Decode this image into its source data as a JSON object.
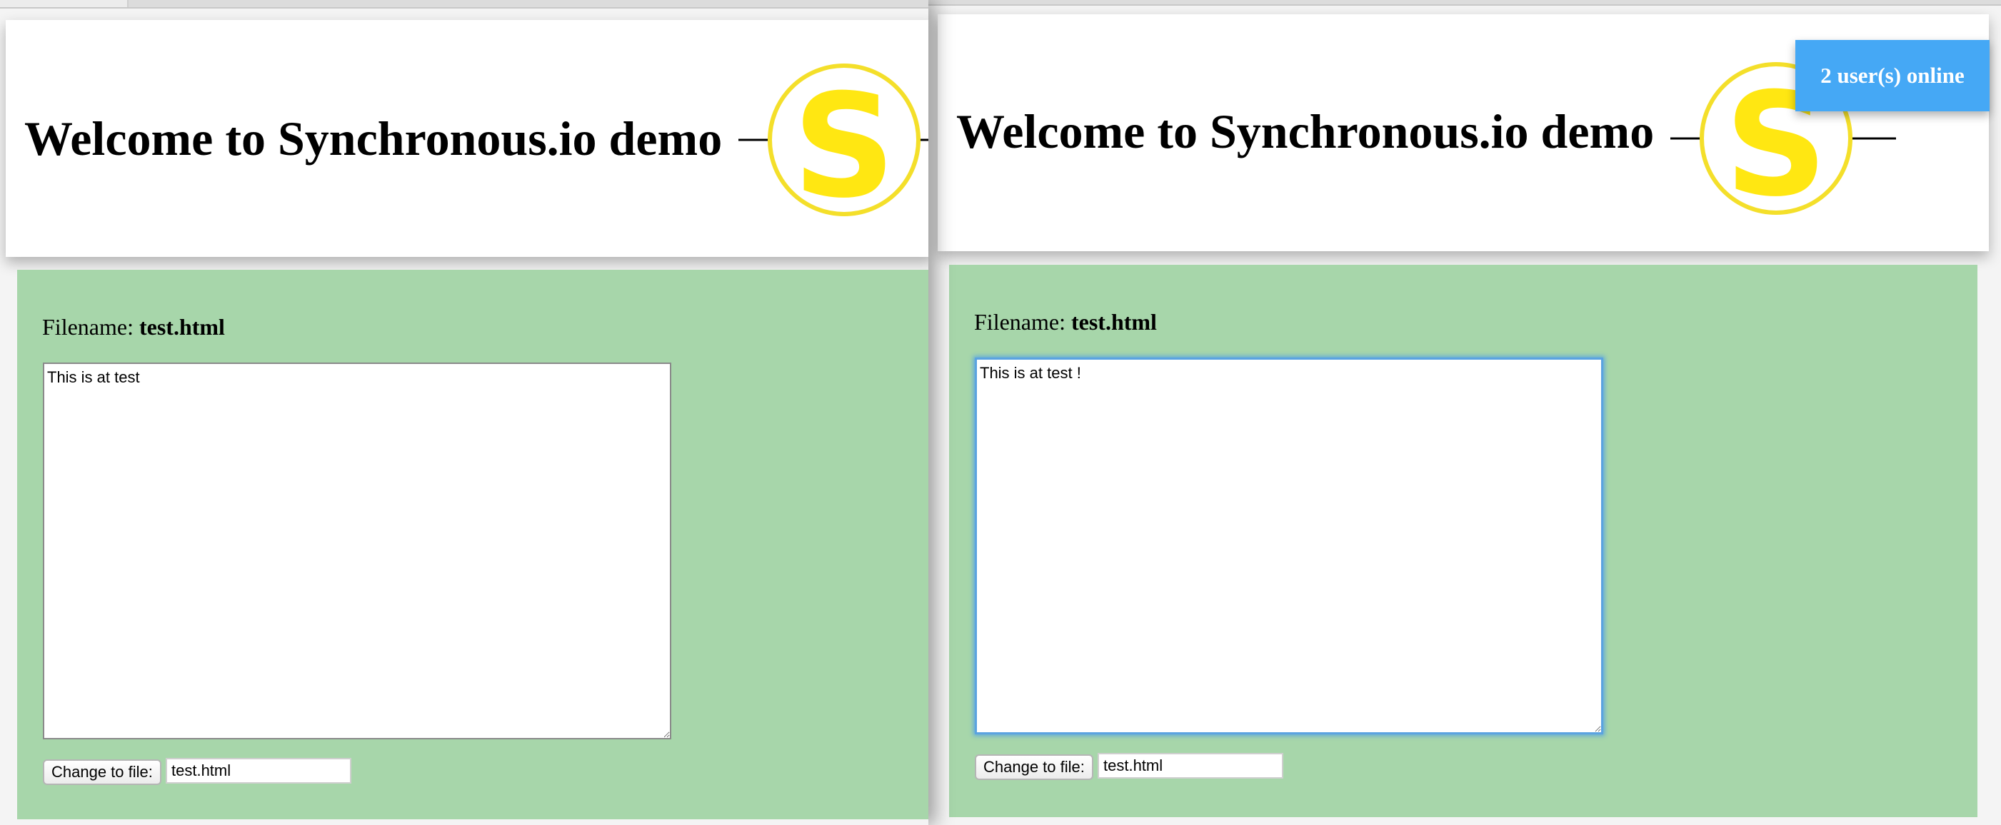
{
  "left_window": {
    "page_title": "Welcome to Synchronous.io demo",
    "logo_letter": "S",
    "filename_label": "Filename:",
    "filename_value": "test.html",
    "editor_text": "This is at test",
    "change_button_label": "Change to file:",
    "file_input_value": "test.html"
  },
  "right_window": {
    "page_title": "Welcome to Synchronous.io demo",
    "logo_letter": "S",
    "users_online": "2 user(s) online",
    "filename_label": "Filename:",
    "filename_value": "test.html",
    "editor_text": "This is at test !",
    "change_button_label": "Change to file:",
    "file_input_value": "test.html"
  },
  "colors": {
    "panel_green": "#a7d6aa",
    "logo_yellow": "#ffe712",
    "badge_blue": "#45a8f5",
    "focus_blue": "#5ba3e0"
  },
  "icons": [
    "synchronous-logo-icon"
  ]
}
